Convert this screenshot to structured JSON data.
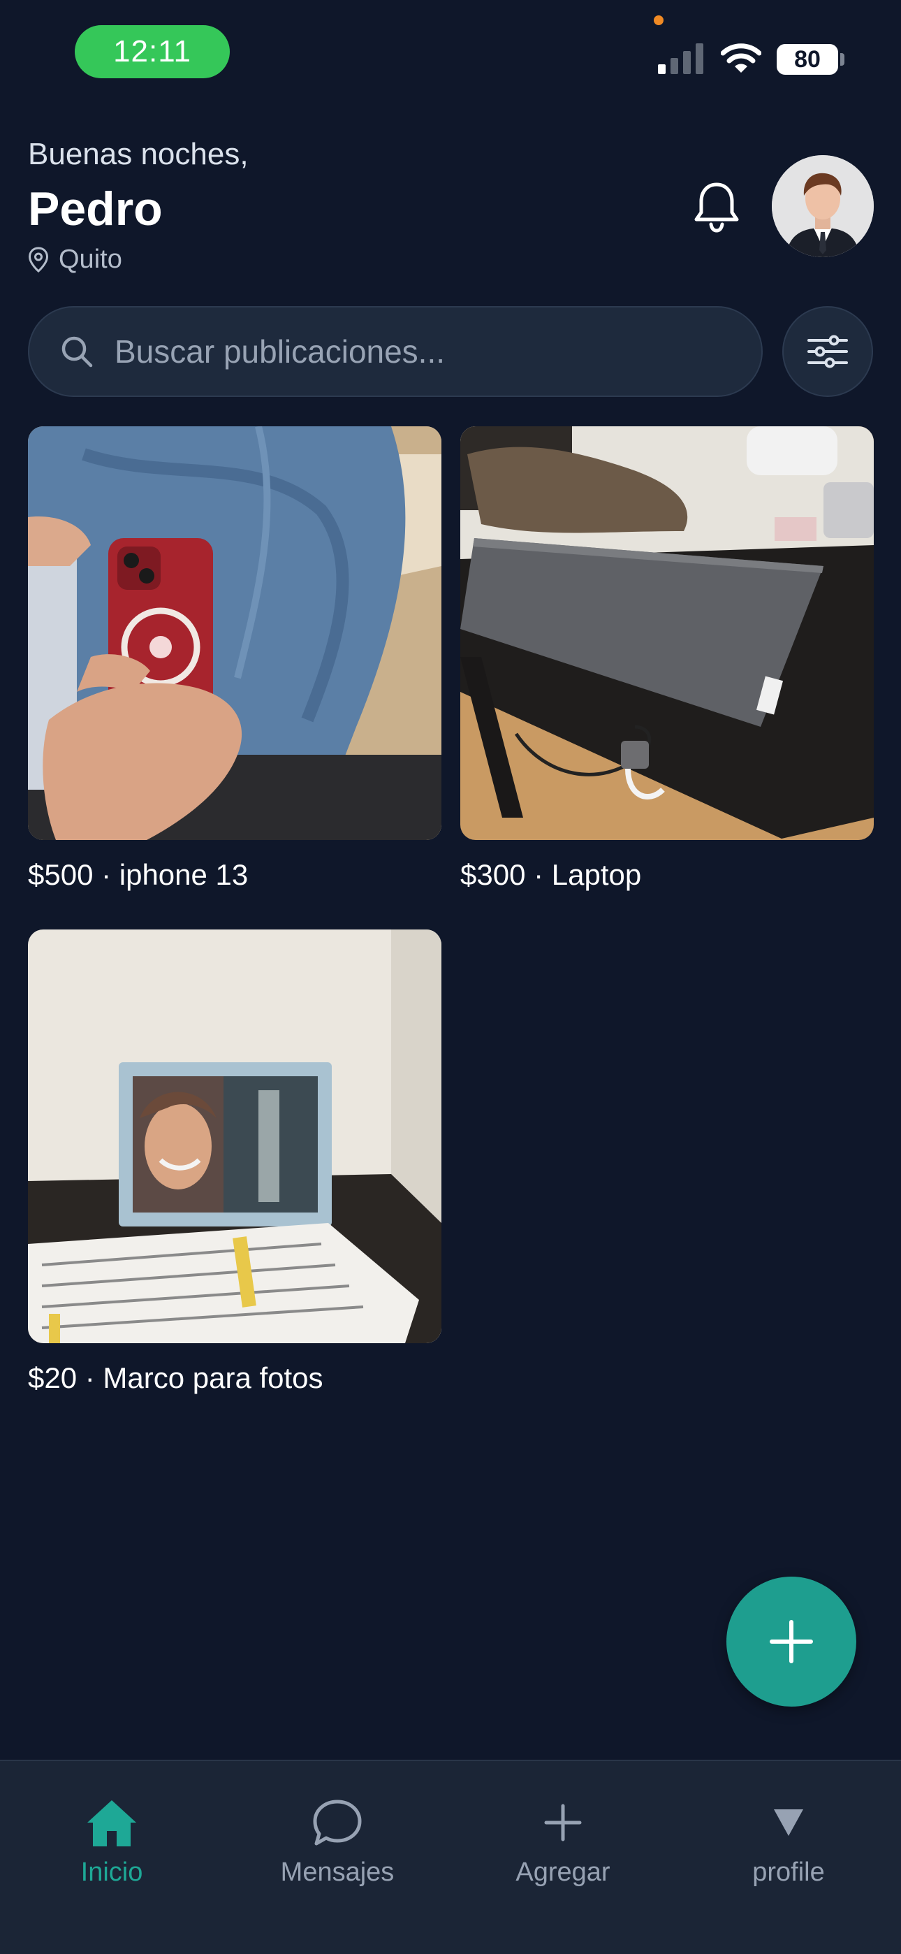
{
  "status_bar": {
    "time": "12:11",
    "battery": "80"
  },
  "header": {
    "greeting": "Buenas noches,",
    "name": "Pedro",
    "location": "Quito"
  },
  "search": {
    "placeholder": "Buscar publicaciones..."
  },
  "listings": [
    {
      "caption": "$500 · iphone 13"
    },
    {
      "caption": "$300 · Laptop"
    },
    {
      "caption": "$20 · Marco para fotos"
    }
  ],
  "nav": {
    "items": [
      {
        "label": "Inicio",
        "icon": "home-icon",
        "active": true
      },
      {
        "label": "Mensajes",
        "icon": "chat-icon"
      },
      {
        "label": "Agregar",
        "icon": "plus-icon"
      },
      {
        "label": "profile",
        "icon": "triangle-down-icon"
      }
    ]
  },
  "colors": {
    "background": "#0f172a",
    "accent": "#1e9e8f",
    "active_nav": "#1ea896",
    "status_pill": "#35c759"
  }
}
